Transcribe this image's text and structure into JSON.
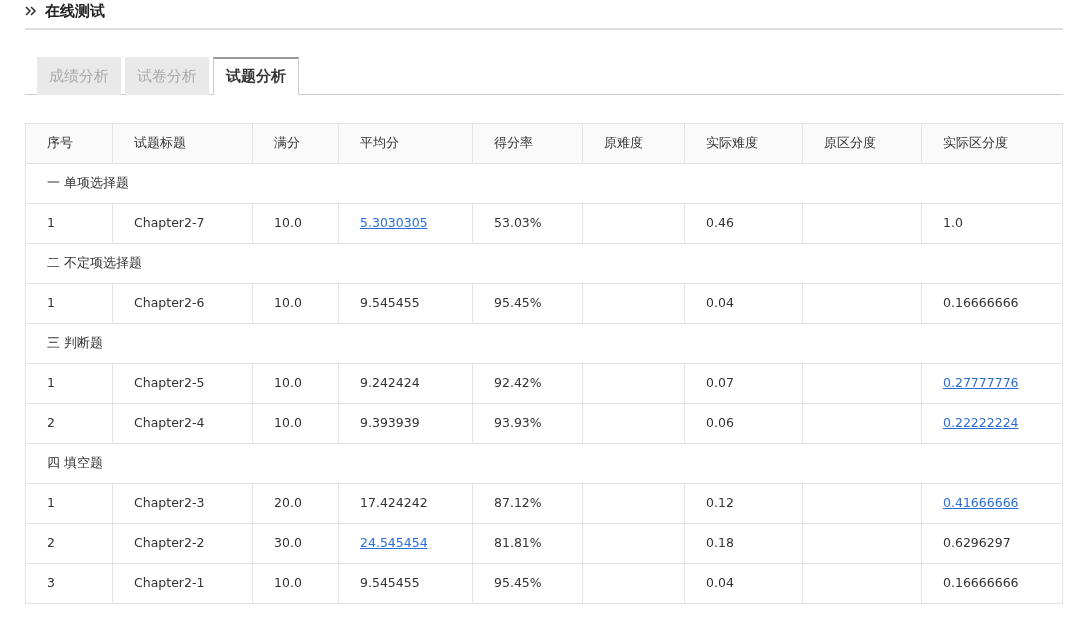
{
  "page_title": "在线测试",
  "tabs": [
    {
      "label": "成绩分析",
      "selected": false
    },
    {
      "label": "试卷分析",
      "selected": false
    },
    {
      "label": "试题分析",
      "selected": true
    }
  ],
  "table": {
    "columns": [
      "序号",
      "试题标题",
      "满分",
      "平均分",
      "得分率",
      "原难度",
      "实际难度",
      "原区分度",
      "实际区分度"
    ],
    "sections": [
      {
        "title": "一 单项选择题",
        "rows": [
          {
            "cells": [
              {
                "text": "1",
                "link": false
              },
              {
                "text": "Chapter2-7",
                "link": false
              },
              {
                "text": "10.0",
                "link": false
              },
              {
                "text": "5.3030305",
                "link": true
              },
              {
                "text": "53.03%",
                "link": false
              },
              null,
              {
                "text": "0.46",
                "link": false
              },
              null,
              {
                "text": "1.0",
                "link": false
              }
            ]
          }
        ]
      },
      {
        "title": "二 不定项选择题",
        "rows": [
          {
            "cells": [
              {
                "text": "1",
                "link": false
              },
              {
                "text": "Chapter2-6",
                "link": false
              },
              {
                "text": "10.0",
                "link": false
              },
              {
                "text": "9.545455",
                "link": false
              },
              {
                "text": "95.45%",
                "link": false
              },
              null,
              {
                "text": "0.04",
                "link": false
              },
              null,
              {
                "text": "0.16666666",
                "link": false
              }
            ]
          }
        ]
      },
      {
        "title": "三 判断题",
        "rows": [
          {
            "cells": [
              {
                "text": "1",
                "link": false
              },
              {
                "text": "Chapter2-5",
                "link": false
              },
              {
                "text": "10.0",
                "link": false
              },
              {
                "text": "9.242424",
                "link": false
              },
              {
                "text": "92.42%",
                "link": false
              },
              null,
              {
                "text": "0.07",
                "link": false
              },
              null,
              {
                "text": "0.27777776",
                "link": true
              }
            ]
          },
          {
            "cells": [
              {
                "text": "2",
                "link": false
              },
              {
                "text": "Chapter2-4",
                "link": false
              },
              {
                "text": "10.0",
                "link": false
              },
              {
                "text": "9.393939",
                "link": false
              },
              {
                "text": "93.93%",
                "link": false
              },
              null,
              {
                "text": "0.06",
                "link": false
              },
              null,
              {
                "text": "0.22222224",
                "link": true
              }
            ]
          }
        ]
      },
      {
        "title": "四 填空题",
        "rows": [
          {
            "cells": [
              {
                "text": "1",
                "link": false
              },
              {
                "text": "Chapter2-3",
                "link": false
              },
              {
                "text": "20.0",
                "link": false
              },
              {
                "text": "17.424242",
                "link": false
              },
              {
                "text": "87.12%",
                "link": false
              },
              null,
              {
                "text": "0.12",
                "link": false
              },
              null,
              {
                "text": "0.41666666",
                "link": true
              }
            ]
          },
          {
            "cells": [
              {
                "text": "2",
                "link": false
              },
              {
                "text": "Chapter2-2",
                "link": false
              },
              {
                "text": "30.0",
                "link": false
              },
              {
                "text": "24.545454",
                "link": true
              },
              {
                "text": "81.81%",
                "link": false
              },
              null,
              {
                "text": "0.18",
                "link": false
              },
              null,
              {
                "text": "0.6296297",
                "link": false
              }
            ]
          },
          {
            "cells": [
              {
                "text": "3",
                "link": false
              },
              {
                "text": "Chapter2-1",
                "link": false
              },
              {
                "text": "10.0",
                "link": false
              },
              {
                "text": "9.545455",
                "link": false
              },
              {
                "text": "95.45%",
                "link": false
              },
              null,
              {
                "text": "0.04",
                "link": false
              },
              null,
              {
                "text": "0.16666666",
                "link": false
              }
            ]
          }
        ]
      }
    ]
  }
}
